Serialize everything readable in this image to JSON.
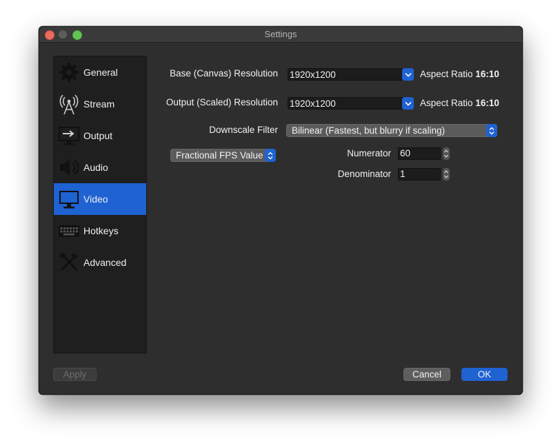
{
  "window": {
    "title": "Settings"
  },
  "sidebar": {
    "items": [
      {
        "label": "General",
        "icon": "gear-icon"
      },
      {
        "label": "Stream",
        "icon": "broadcast-tower-icon"
      },
      {
        "label": "Output",
        "icon": "output-monitor-icon"
      },
      {
        "label": "Audio",
        "icon": "speaker-icon"
      },
      {
        "label": "Video",
        "icon": "monitor-icon",
        "active": true
      },
      {
        "label": "Hotkeys",
        "icon": "keyboard-icon"
      },
      {
        "label": "Advanced",
        "icon": "tools-icon"
      }
    ]
  },
  "video": {
    "base_resolution_label": "Base (Canvas) Resolution",
    "base_resolution_value": "1920x1200",
    "base_aspect_label": "Aspect Ratio",
    "base_aspect_value": "16:10",
    "output_resolution_label": "Output (Scaled) Resolution",
    "output_resolution_value": "1920x1200",
    "output_aspect_label": "Aspect Ratio",
    "output_aspect_value": "16:10",
    "downscale_label": "Downscale Filter",
    "downscale_value": "Bilinear (Fastest, but blurry if scaling)",
    "fps_type_value": "Fractional FPS Value",
    "numerator_label": "Numerator",
    "numerator_value": "60",
    "denominator_label": "Denominator",
    "denominator_value": "1"
  },
  "footer": {
    "apply_label": "Apply",
    "cancel_label": "Cancel",
    "ok_label": "OK"
  },
  "colors": {
    "accent": "#1f62d2",
    "window_bg": "#2e2e2e",
    "sidebar_bg": "#1f1f1f"
  }
}
